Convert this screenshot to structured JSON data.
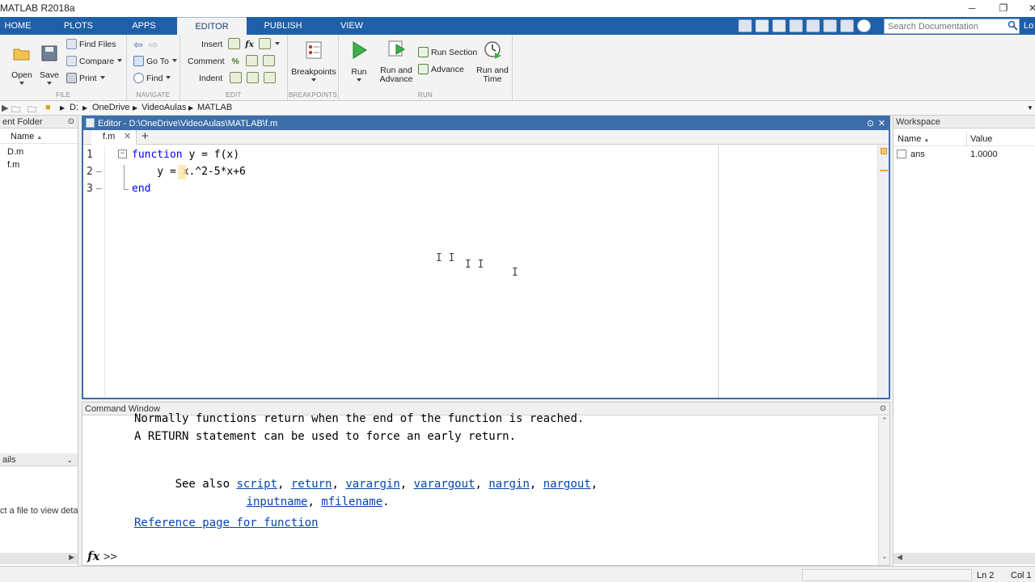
{
  "window": {
    "title": "MATLAB R2018a",
    "minimize": "─",
    "restore": "❐",
    "close": "✕"
  },
  "tabs": [
    "HOME",
    "PLOTS",
    "APPS",
    "EDITOR",
    "PUBLISH",
    "VIEW"
  ],
  "active_tab": "EDITOR",
  "search": {
    "placeholder": "Search Documentation"
  },
  "lo_label": "Lo",
  "ribbon": {
    "file": {
      "label": "FILE",
      "open": "Open",
      "save": "Save",
      "find_files": "Find Files",
      "compare": "Compare",
      "print": "Print"
    },
    "navigate": {
      "label": "NAVIGATE",
      "go_to": "Go To",
      "find": "Find"
    },
    "edit": {
      "label": "EDIT",
      "insert": "Insert",
      "comment": "Comment",
      "indent": "Indent",
      "fx": "fx"
    },
    "breakpoints": {
      "label": "BREAKPOINTS",
      "breakpoints": "Breakpoints"
    },
    "run": {
      "label": "RUN",
      "run": "Run",
      "run_and_advance_1": "Run and",
      "run_and_advance_2": "Advance",
      "run_section": "Run Section",
      "advance": "Advance",
      "run_and_time_1": "Run and",
      "run_and_time_2": "Time"
    }
  },
  "address": [
    "D:",
    "OneDrive",
    "VideoAulas",
    "MATLAB"
  ],
  "current_folder": {
    "title": "ent Folder",
    "column": "Name",
    "files": [
      "D.m",
      "f.m"
    ],
    "details_title": "ails",
    "details_text": "ct a file to view detai"
  },
  "editor": {
    "title": "Editor - D:\\OneDrive\\VideoAulas\\MATLAB\\f.m",
    "tab": "f.m",
    "lines": [
      {
        "num": "1",
        "marker": "",
        "kw1": "function",
        "text": " y = f(x)",
        "kw2": ""
      },
      {
        "num": "2",
        "marker": "—",
        "kw1": "",
        "text": "    y = x.^2-5*x+6",
        "kw2": ""
      },
      {
        "num": "3",
        "marker": "—",
        "kw1": "end",
        "text": "",
        "kw2": ""
      }
    ]
  },
  "command_window": {
    "title": "Command Window",
    "lines": {
      "l1": "Normally functions return when the end of the function is reached.",
      "l2": "A RETURN statement can be used to force an early return.",
      "see_also": "See also ",
      "links1": [
        "script",
        "return",
        "varargin",
        "varargout",
        "nargin",
        "nargout"
      ],
      "links2": [
        "inputname",
        "mfilename"
      ],
      "ref": "Reference page for function"
    },
    "prompt_fx": "fx",
    "prompt": ">>"
  },
  "workspace": {
    "title": "Workspace",
    "col_name": "Name",
    "col_value": "Value",
    "vars": [
      {
        "name": "ans",
        "value": "1.0000"
      }
    ]
  },
  "status": {
    "ln": "Ln  2",
    "col": "Col  1"
  }
}
